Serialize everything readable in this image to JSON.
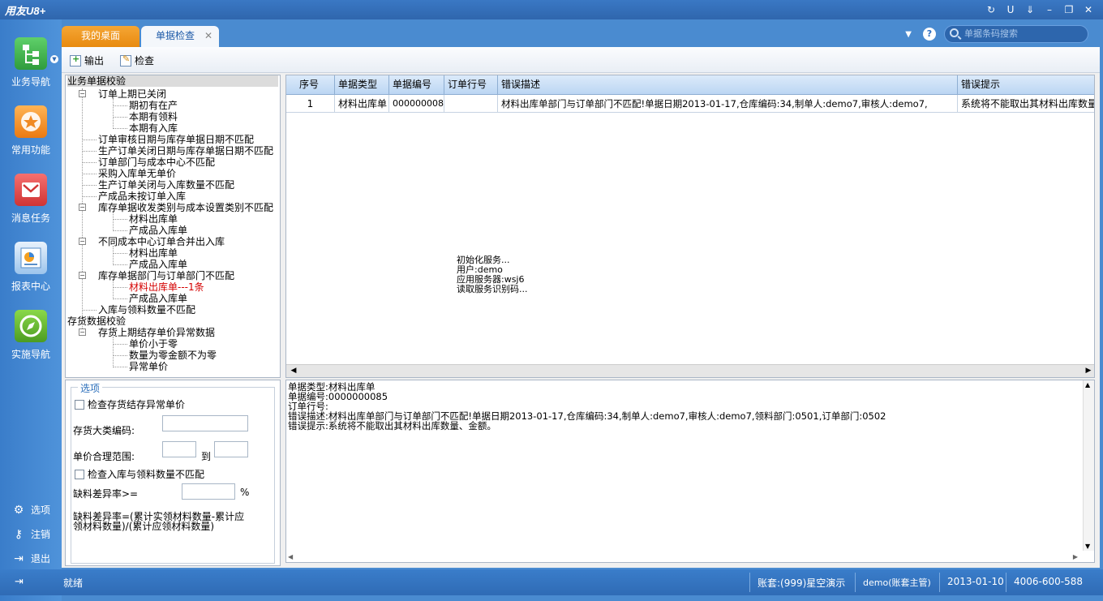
{
  "app": {
    "logo": "用友U8+"
  },
  "window_controls": [
    "↻",
    "U",
    "⇓",
    "–",
    "❐",
    "✕"
  ],
  "leftnav": {
    "items": [
      {
        "label": "业务导航",
        "icon": "business-nav-icon",
        "color": "#3cb54a"
      },
      {
        "label": "常用功能",
        "icon": "favorites-star-icon",
        "color": "#f08a24"
      },
      {
        "label": "消息任务",
        "icon": "message-mail-icon",
        "color": "#e04848"
      },
      {
        "label": "报表中心",
        "icon": "report-chart-icon",
        "color": "#4a90d9"
      },
      {
        "label": "实施导航",
        "icon": "compass-icon",
        "color": "#66b832"
      }
    ],
    "bottom": [
      {
        "label": "选项",
        "icon": "gear-icon"
      },
      {
        "label": "注销",
        "icon": "key-icon"
      },
      {
        "label": "退出",
        "icon": "exit-icon"
      }
    ]
  },
  "tabs": [
    {
      "label": "我的桌面"
    },
    {
      "label": "单据检查",
      "close": "✕"
    }
  ],
  "search": {
    "placeholder": "单据条码搜索"
  },
  "toolbar": {
    "export_label": "输出",
    "check_label": "检查"
  },
  "tree": {
    "root1": "业务单据校验",
    "n1": "订单上期已关闭",
    "n1a": "期初有在产",
    "n1b": "本期有领料",
    "n1c": "本期有入库",
    "n2": "订单审核日期与库存单据日期不匹配",
    "n3": "生产订单关闭日期与库存单据日期不匹配",
    "n4": "订单部门与成本中心不匹配",
    "n5": "采购入库单无单价",
    "n6": "生产订单关闭与入库数量不匹配",
    "n7": "产成品未按订单入库",
    "n8": "库存单据收发类别与成本设置类别不匹配",
    "n8a": "材料出库单",
    "n8b": "产成品入库单",
    "n9": "不同成本中心订单合并出入库",
    "n9a": "材料出库单",
    "n9b": "产成品入库单",
    "n10": "库存单据部门与订单部门不匹配",
    "n10a": "材料出库单---1条",
    "n10b": "产成品入库单",
    "n11": "入库与领料数量不匹配",
    "root2": "存货数据校验",
    "n12": "存货上期结存单价异常数据",
    "n12a": "单价小于零",
    "n12b": "数量为零金额不为零",
    "n12c": "异常单价"
  },
  "options": {
    "legend": "选项",
    "chk1": "检查存货结存异常单价",
    "cat_label": "存货大类编码:",
    "range_label": "单价合理范围:",
    "to": "到",
    "chk2": "检查入库与领料数量不匹配",
    "rate_label": "缺料差异率>=",
    "pct": "%",
    "formula1": "缺料差异率=(累计实领材料数量-累计应",
    "formula2": "领材料数量)/(累计应领材料数量)"
  },
  "grid": {
    "headers": [
      "序号",
      "单据类型",
      "单据编号",
      "订单行号",
      "错误描述",
      "错误提示"
    ],
    "row": [
      "1",
      "材料出库单",
      "0000000085",
      "",
      "材料出库单部门与订单部门不匹配!单据日期2013-01-17,仓库编码:34,制单人:demo7,审核人:demo7,",
      "系统将不能取出其材料出库数量"
    ],
    "loading": "初始化服务...\n用户:demo\n应用服务器:wsj6\n读取服务识别码..."
  },
  "detail": {
    "l1": "单据类型:材料出库单",
    "l2": "单据编号:0000000085",
    "l3": "订单行号:",
    "l4": "错误描述:材料出库单部门与订单部门不匹配!单据日期2013-01-17,仓库编码:34,制单人:demo7,审核人:demo7,领料部门:0501,订单部门:0502",
    "l5": "错误提示:系统将不能取出其材料出库数量、金额。"
  },
  "status": {
    "ready": "就绪",
    "account": "账套:(999)星空演示",
    "user": "demo(账套主管)",
    "date": "2013-01-10",
    "phone": "4006-600-588"
  }
}
